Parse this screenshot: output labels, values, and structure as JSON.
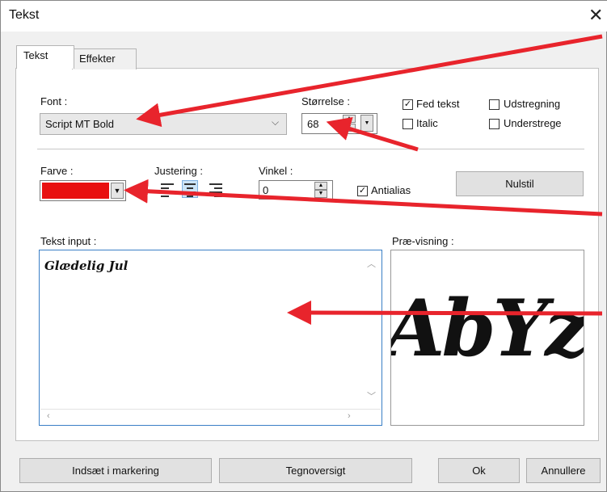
{
  "window": {
    "title": "Tekst"
  },
  "tabs": [
    {
      "label": "Tekst"
    },
    {
      "label": "Effekter"
    }
  ],
  "font": {
    "label": "Font :",
    "value": "Script MT Bold"
  },
  "size": {
    "label": "Størrelse :",
    "value": "68"
  },
  "checkboxes": {
    "bold": {
      "label": "Fed tekst",
      "checked": true
    },
    "italic": {
      "label": "Italic",
      "checked": false
    },
    "strikeout": {
      "label": "Udstregning",
      "checked": false
    },
    "underline": {
      "label": "Understrege",
      "checked": false
    },
    "antialias": {
      "label": "Antialias",
      "checked": true
    }
  },
  "color": {
    "label": "Farve :",
    "value": "#e81010"
  },
  "alignment": {
    "label": "Justering :",
    "options": [
      "left",
      "center",
      "right"
    ],
    "selected": "center"
  },
  "angle": {
    "label": "Vinkel :",
    "value": "0"
  },
  "reset_button": "Nulstil",
  "text_input": {
    "label": "Tekst input :",
    "value": "Glædelig Jul"
  },
  "preview": {
    "label": "Præ-visning :",
    "sample": "AbYz"
  },
  "footer": {
    "insert_button": "Indsæt i markering",
    "charmap_button": "Tegnoversigt",
    "ok_button": "Ok",
    "cancel_button": "Annullere"
  },
  "annotation_color": "#e8242c"
}
